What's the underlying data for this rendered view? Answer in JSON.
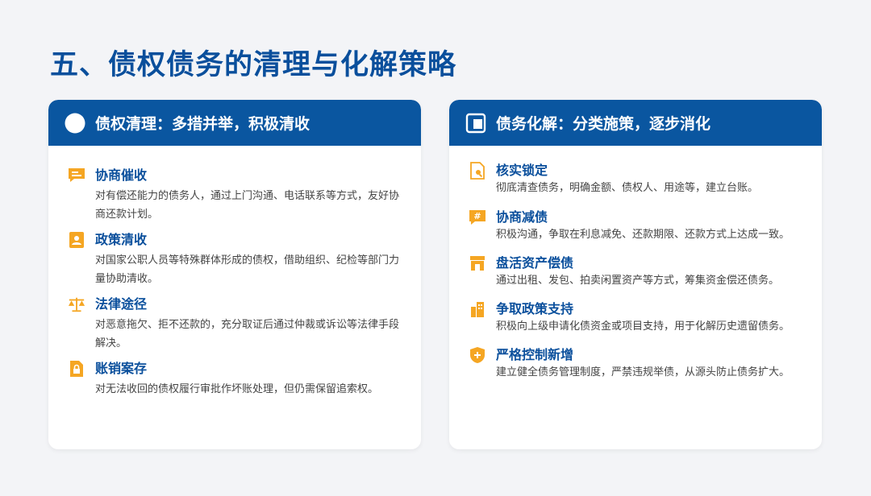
{
  "page": {
    "title": "五、债权债务的清理与化解策略"
  },
  "left": {
    "header": "债权清理：多措并举，积极清收",
    "items": [
      {
        "title": "协商催收",
        "desc": "对有偿还能力的债务人，通过上门沟通、电话联系等方式，友好协商还款计划。",
        "icon": "chat-icon"
      },
      {
        "title": "政策清收",
        "desc": "对国家公职人员等特殊群体形成的债权，借助组织、纪检等部门力量协助清收。",
        "icon": "person-document-icon"
      },
      {
        "title": "法律途径",
        "desc": "对恶意拖欠、拒不还款的，充分取证后通过仲裁或诉讼等法律手段解决。",
        "icon": "scales-icon"
      },
      {
        "title": "账销案存",
        "desc": "对无法收回的债权履行审批作坏账处理，但仍需保留追索权。",
        "icon": "locked-document-icon"
      }
    ]
  },
  "right": {
    "header": "债务化解：分类施策，逐步消化",
    "items": [
      {
        "title": "核实锁定",
        "desc": "彻底清查债务，明确金额、债权人、用途等，建立台账。",
        "icon": "search-document-icon"
      },
      {
        "title": "协商减债",
        "desc": "积极沟通，争取在利息减免、还款期限、还款方式上达成一致。",
        "icon": "hash-chat-icon"
      },
      {
        "title": "盘活资产偿债",
        "desc": "通过出租、发包、拍卖闲置资产等方式，筹集资金偿还债务。",
        "icon": "store-icon"
      },
      {
        "title": "争取政策支持",
        "desc": "积极向上级申请化债资金或项目支持，用于化解历史遗留债务。",
        "icon": "building-icon"
      },
      {
        "title": "严格控制新增",
        "desc": "建立健全债务管理制度，严禁违规举债，从源头防止债务扩大。",
        "icon": "shield-icon"
      }
    ]
  },
  "colors": {
    "accent": "#0a56a0",
    "title": "#0a4f9c",
    "icon": "#f5a623"
  }
}
